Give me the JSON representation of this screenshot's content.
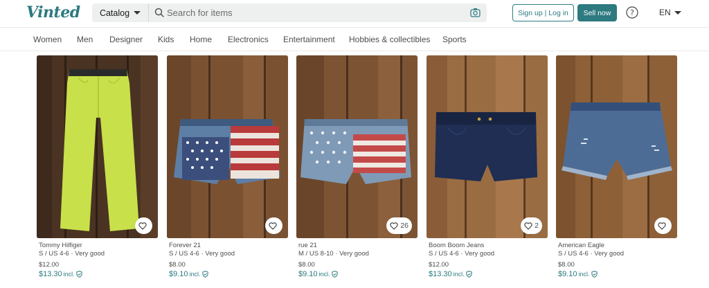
{
  "header": {
    "logo": "Vinted",
    "catalog_label": "Catalog",
    "search_placeholder": "Search for items",
    "signup_label": "Sign up | Log in",
    "sell_label": "Sell now",
    "language": "EN"
  },
  "nav": {
    "categories": [
      "Women",
      "Men",
      "Designer",
      "Kids",
      "Home",
      "Electronics",
      "Entertainment",
      "Hobbies & collectibles",
      "Sports"
    ]
  },
  "listings": [
    {
      "brand": "Tommy Hilfiger",
      "size_condition": "S / US 4-6 · Very good",
      "price": "$12.00",
      "price_incl": "$13.30",
      "incl_label": "incl.",
      "likes": "",
      "item": "lime-chino-pants"
    },
    {
      "brand": "Forever 21",
      "size_condition": "S / US 4-6 · Very good",
      "price": "$8.00",
      "price_incl": "$9.10",
      "incl_label": "incl.",
      "likes": "",
      "item": "flag-denim-shorts"
    },
    {
      "brand": "rue 21",
      "size_condition": "M / US 8-10 · Very good",
      "price": "$8.00",
      "price_incl": "$9.10",
      "incl_label": "incl.",
      "likes": "26",
      "item": "flag-denim-shorts-light"
    },
    {
      "brand": "Boom Boom Jeans",
      "size_condition": "S / US 4-6 · Very good",
      "price": "$12.00",
      "price_incl": "$13.30",
      "incl_label": "incl.",
      "likes": "2",
      "item": "dark-denim-shorts"
    },
    {
      "brand": "American Eagle",
      "size_condition": "S / US 4-6 · Very good",
      "price": "$8.00",
      "price_incl": "$9.10",
      "incl_label": "incl.",
      "likes": "",
      "item": "distressed-denim-shorts"
    }
  ],
  "colors": {
    "accent": "#2d7a80",
    "wood": "#6e4c2c"
  }
}
